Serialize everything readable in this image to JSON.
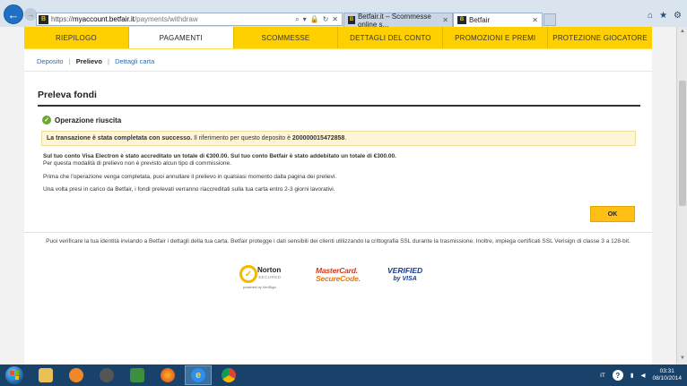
{
  "browser": {
    "url_scheme": "https://",
    "url_host": "myaccount.betfair.it",
    "url_path": "/payments/withdraw",
    "site_favicon": "B",
    "addr_tools": [
      "⌕",
      "▾",
      "🔒",
      "↻",
      "✕"
    ],
    "tabs": [
      {
        "label": "Betfair.it – Scommesse online s...",
        "close": "✕"
      },
      {
        "label": "Betfair",
        "close": "✕"
      }
    ],
    "window_icons": [
      "⌂",
      "★",
      "⚙"
    ]
  },
  "main_tabs": [
    "RIEPILOGO",
    "PAGAMENTI",
    "SCOMMESSE",
    "DETTAGLI DEL CONTO",
    "PROMOZIONI E PREMI",
    "PROTEZIONE GIOCATORE"
  ],
  "subnav": {
    "deposit": "Deposito",
    "withdraw": "Prelievo",
    "card_details": "Dettagli carta",
    "separator": "|"
  },
  "section_title": "Preleva fondi",
  "success": {
    "heading": "Operazione riuscita",
    "notice_bold": "La transazione è stata completata con successo.",
    "notice_text": " Il riferimento per questo deposito è ",
    "reference": "200000015472858",
    "notice_end": "."
  },
  "body": {
    "line1": "Sul tuo conto Visa Electron è stato accreditato un totale di €300.00. Sul tuo conto Betfair è stato addebitato un totale di €300.00.",
    "line2": "Per questa modalità di prelievo non è previsto alcun tipo di commissione.",
    "line3": "Prima che l'operazione venga completata, puoi annullare il prelievo in qualsiasi momento dalla pagina dei prelievi.",
    "line4": "Una volta presi in carico da Betfair, i fondi prelevati verranno riaccreditati sulla tua carta entro 2-3 giorni lavorativi."
  },
  "ok_label": "OK",
  "footer_text": "Puoi verificare la tua identità inviando a Betfair i dettagli della tua carta. Betfair protegge i dati sensibili dei clienti utilizzando la crittografia SSL durante la trasmissione. Inoltre, impiega certificati SSL Verisign di classe 3 a 128-bit.",
  "logos": {
    "norton_main": "Norton",
    "norton_sub": "SECURED",
    "norton_powered": "powered by VeriSign",
    "mastercard_1": "MasterCard.",
    "mastercard_2": "SecureCode.",
    "visa_1": "VERIFIED",
    "visa_2": "by VISA"
  },
  "taskbar": {
    "language": "IT",
    "time": "03:31",
    "date": "08/10/2014"
  },
  "colors": {
    "accent_yellow": "#ffd000",
    "ok_button": "#ffbf14",
    "success_green": "#6aa82a",
    "link_blue": "#2a6db5",
    "taskbar": "#19426a"
  }
}
